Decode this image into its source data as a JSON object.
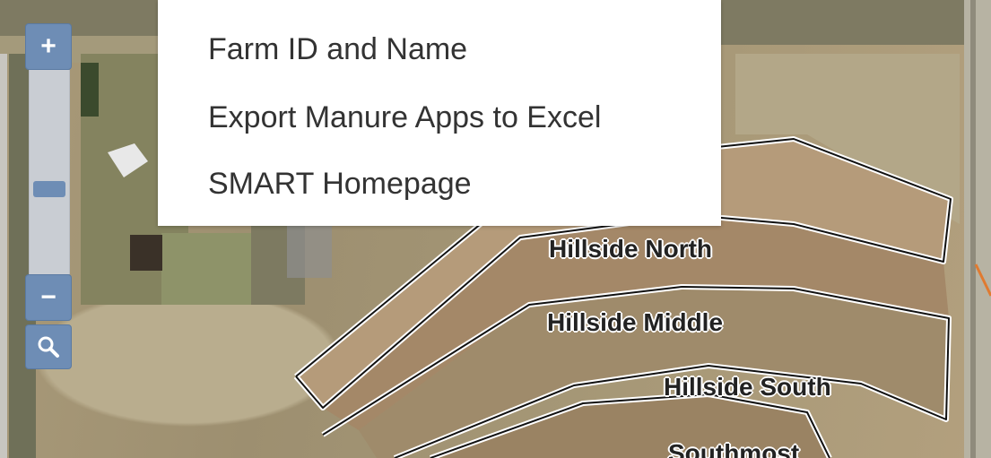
{
  "menu": {
    "items": [
      {
        "label": "Farm ID and Name"
      },
      {
        "label": "Export Manure Apps to Excel"
      },
      {
        "label": "SMART Homepage"
      }
    ]
  },
  "map": {
    "zoom_in_label": "+",
    "zoom_out_label": "−",
    "zoom_in_icon": "plus-icon",
    "zoom_out_icon": "minus-icon",
    "search_icon": "magnifier-icon",
    "field_labels": [
      "Hillside North",
      "Hillside Middle",
      "Hillside South",
      "Southmost"
    ],
    "colors": {
      "control_blue": "#6e8db5",
      "field_outline": "#ffffff"
    }
  }
}
